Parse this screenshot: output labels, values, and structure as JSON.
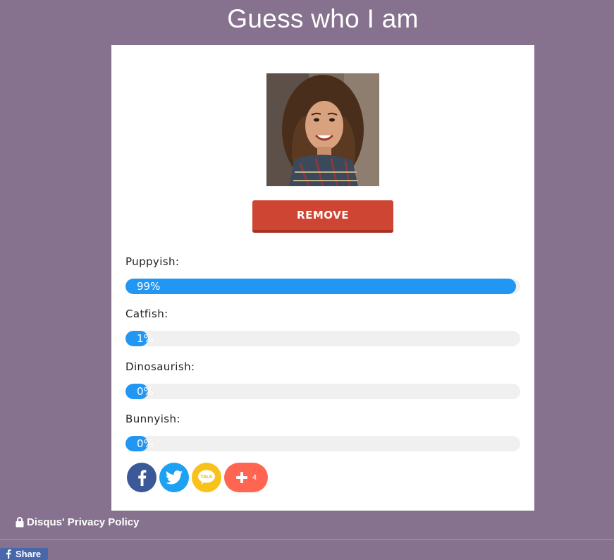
{
  "page": {
    "title": "Guess who I am"
  },
  "card": {
    "photo_alt": "profile photo",
    "remove_label": "REMOVE",
    "results": [
      {
        "label": "Puppyish:",
        "percent": 99,
        "display": "99%"
      },
      {
        "label": "Catfish:",
        "percent": 1,
        "display": "1%"
      },
      {
        "label": "Dinosaurish:",
        "percent": 0,
        "display": "0%"
      },
      {
        "label": "Bunnyish:",
        "percent": 0,
        "display": "0%"
      }
    ],
    "share": {
      "facebook_icon": "facebook-icon",
      "twitter_icon": "twitter-icon",
      "kakao_icon": "kakaotalk-icon",
      "kakao_text": "TALK",
      "more_icon": "plus-icon",
      "more_count": "4"
    }
  },
  "footer": {
    "privacy_label": "Disqus' Privacy Policy",
    "privacy_icon": "lock-icon",
    "share_label": "Share",
    "share_icon": "facebook-f-icon"
  },
  "colors": {
    "background": "#86718e",
    "bar_fill": "#2196f3",
    "bar_track": "#f0f0f0",
    "remove_button": "#cf4533"
  }
}
